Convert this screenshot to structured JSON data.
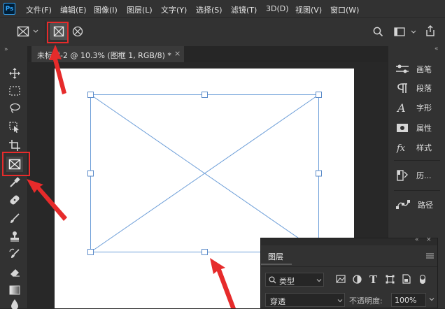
{
  "app": {
    "logo": "Ps"
  },
  "menubar": {
    "items": [
      "文件(F)",
      "编辑(E)",
      "图像(I)",
      "图层(L)",
      "文字(Y)",
      "选择(S)",
      "滤镜(T)",
      "3D(D)",
      "视图(V)",
      "窗口(W)"
    ]
  },
  "document": {
    "tab_title": "未标题-2 @ 10.3% (图框 1, RGB/8) *",
    "close": "×"
  },
  "panels": {
    "items": [
      {
        "label": "画笔",
        "icon": "brush-settings-icon"
      },
      {
        "label": "段落",
        "icon": "paragraph-icon"
      },
      {
        "label": "字形",
        "icon": "glyphs-icon"
      },
      {
        "label": "属性",
        "icon": "properties-icon"
      },
      {
        "label": "样式",
        "icon": "styles-icon"
      },
      {
        "label": "历...",
        "icon": "history-icon"
      },
      {
        "label": "路径",
        "icon": "paths-icon"
      }
    ]
  },
  "layers_panel": {
    "title": "图层",
    "filter_label": "类型",
    "blend_mode": "穿透",
    "opacity_label": "不透明度:",
    "opacity_value": "100%"
  },
  "colors": {
    "accent_red": "#e62b2b",
    "frame_line": "#6d9ed8",
    "handle": "#5b8bc9"
  }
}
